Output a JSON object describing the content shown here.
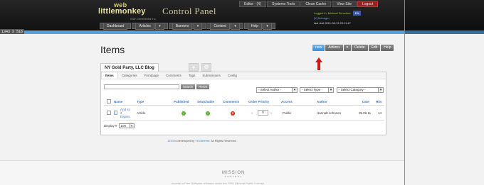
{
  "screen_size_badge": "1343 X 516",
  "header": {
    "logo_top": "web",
    "logo_main": "littlemonkey",
    "logo_sub": "ISW OmniMedia Inc.",
    "app_title": "Control Panel",
    "top_links": [
      "Editor - (X)",
      "Systems Tools",
      "Clean Cache",
      "View Site",
      "Logout"
    ],
    "logged_in": "Logged in: Michael Schreiber",
    "lang": "EN",
    "role": "[X] Manager",
    "last_visit": "last visit 2011-08-13 20:11:47",
    "nav": [
      {
        "label": "Dashboard",
        "has_menu": false
      },
      {
        "label": "Articles",
        "has_menu": true
      },
      {
        "label": "Banners",
        "has_menu": true
      },
      {
        "label": "Content",
        "has_menu": true
      },
      {
        "label": "Help",
        "has_menu": true
      }
    ]
  },
  "page": {
    "title": "Items",
    "actions": [
      "new",
      "Actions",
      "▾",
      "Delete",
      "Edit",
      "Help"
    ],
    "app_tab": "NY Gold Party, LLC Blog",
    "subtabs": [
      "Items",
      "Categories",
      "Frontpage",
      "Comments",
      "Tags",
      "Submissions",
      "Config"
    ],
    "search_button": "Search",
    "reset_button": "Reset",
    "filters": [
      "- Select Author -",
      "- Select Type -",
      "- Select Category -"
    ],
    "table": {
      "headers": [
        "Name",
        "Type",
        "Published",
        "Searchable",
        "Comments",
        "Order Priority",
        "Access",
        "Author",
        "Date",
        "Hits"
      ],
      "rows": [
        {
          "name_line1": "And so",
          "name_line2": "it",
          "name_line3": "begins.",
          "type": "Article",
          "published": "✓",
          "searchable": "✓",
          "comments": "✕",
          "order_priority": "0",
          "access": "Public",
          "author": "Hannah Johnson",
          "date": "09.06.11",
          "hits": "14"
        }
      ]
    },
    "display_label": "Display #",
    "display_value": "100"
  },
  "footer": {
    "text_pre": "ZOO",
    "text_mid": " is developed by ",
    "text_link": "YOOtheme",
    "text_post": ". All Rights Reserved.",
    "brand": "MISSION",
    "brand_sub": "CONTROL",
    "copyright": "Joomla! is Free Software released under the GNU General Public License."
  },
  "colors": {
    "accent": "#5aa0d8",
    "new_button": "#3d8fd8",
    "logout": "#9a1f1f",
    "arrow": "#d01818",
    "published": "#59b032",
    "unpublished": "#d9331e"
  }
}
